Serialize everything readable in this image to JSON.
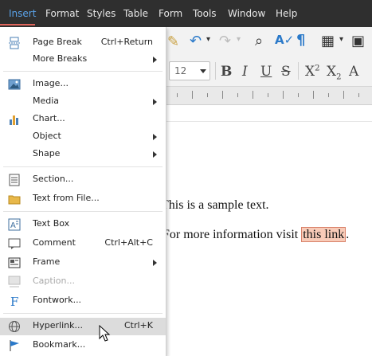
{
  "menubar": {
    "items": [
      "Insert",
      "Format",
      "Styles",
      "Table",
      "Form",
      "Tools",
      "Window",
      "Help"
    ],
    "active": "Insert"
  },
  "toolbar": {
    "font_size": "12"
  },
  "document": {
    "line1": "This is a sample text.",
    "line2_prefix": "For more information visit ",
    "link_text": "this link",
    "line2_suffix": "."
  },
  "insert_menu": {
    "page_break": {
      "label": "Page Break",
      "shortcut": "Ctrl+Return"
    },
    "more_breaks": {
      "label": "More Breaks"
    },
    "image": {
      "label": "Image..."
    },
    "media": {
      "label": "Media"
    },
    "chart": {
      "label": "Chart..."
    },
    "object": {
      "label": "Object"
    },
    "shape": {
      "label": "Shape"
    },
    "section": {
      "label": "Section..."
    },
    "text_from_file": {
      "label": "Text from File..."
    },
    "text_box": {
      "label": "Text Box"
    },
    "comment": {
      "label": "Comment",
      "shortcut": "Ctrl+Alt+C"
    },
    "frame": {
      "label": "Frame"
    },
    "caption": {
      "label": "Caption..."
    },
    "fontwork": {
      "label": "Fontwork..."
    },
    "hyperlink": {
      "label": "Hyperlink...",
      "shortcut": "Ctrl+K"
    },
    "bookmark": {
      "label": "Bookmark..."
    }
  },
  "colors": {
    "menubar_bg": "#2f2f2f",
    "active_menu": "#5aa2e8",
    "link_highlight": "#f8cbb8",
    "hover_row": "#dcdcdc"
  }
}
